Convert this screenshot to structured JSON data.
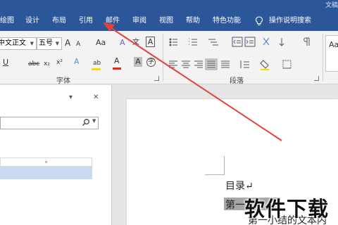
{
  "window": {
    "title_fragment": "文稿"
  },
  "tabs": [
    {
      "label": "绘图"
    },
    {
      "label": "设计"
    },
    {
      "label": "布局"
    },
    {
      "label": "引用"
    },
    {
      "label": "邮件"
    },
    {
      "label": "审阅"
    },
    {
      "label": "视图"
    },
    {
      "label": "帮助"
    },
    {
      "label": "特色功能"
    }
  ],
  "tell_me": {
    "label": "操作说明搜索"
  },
  "font": {
    "font_name": "中文正文",
    "font_size": "五号",
    "group_label": "字体",
    "buttons": {
      "grow": "A",
      "shrink": "A",
      "change_case": "Aa",
      "clear_format": "A",
      "phonetic": "文",
      "char_border": "A",
      "underline": "U",
      "strike": "abc",
      "subscript": "x₂",
      "superscript": "x²",
      "effects": "A",
      "highlight": "ab",
      "font_color": "A",
      "char_shading": "A",
      "enclose": "字"
    }
  },
  "paragraph": {
    "group_label": "段落"
  },
  "styles": {
    "preview": "Aa"
  },
  "nav_pane": {
    "dropdown_glyph": "▾",
    "close_glyph": "✕",
    "row_marker": "⌅"
  },
  "document": {
    "heading": "目录↵",
    "item1_visible": "第一",
    "body": "第一小结的文本内"
  },
  "watermark": {
    "text": "软件下载"
  },
  "colors": {
    "ribbon_blue": "#2b579a",
    "font_color_bar": "#e0291b",
    "highlight_bar": "#ffd800",
    "arrow": "#e8413d"
  }
}
